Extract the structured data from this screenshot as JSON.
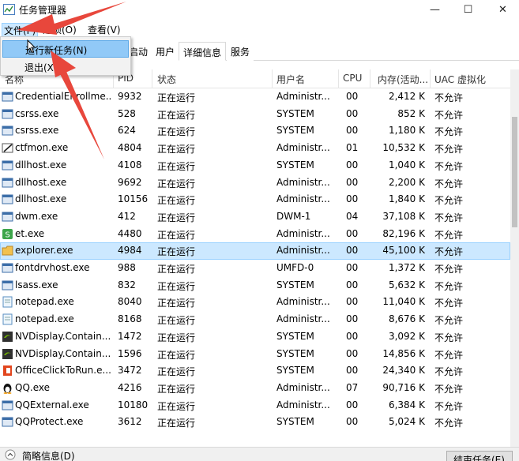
{
  "window": {
    "title": "任务管理器",
    "minimize": "—",
    "maximize": "☐",
    "close": "✕"
  },
  "menu": {
    "file": "文件(F)",
    "options": "选项(O)",
    "view": "查看(V)"
  },
  "dropdown": {
    "run_new_task": "运行新任务(N)",
    "exit": "退出(X)"
  },
  "tabs": [
    "启动",
    "用户",
    "详细信息",
    "服务"
  ],
  "columns": {
    "name": "名称",
    "pid": "PID",
    "status": "状态",
    "user": "用户名",
    "cpu": "CPU",
    "memory": "内存(活动...",
    "uac": "UAC 虚拟化"
  },
  "processes": [
    {
      "name": "CredentialEnrollme...",
      "pid": "9932",
      "status": "正在运行",
      "user": "Administr...",
      "cpu": "00",
      "mem": "2,412 K",
      "uac": "不允许",
      "icon": "window-icon"
    },
    {
      "name": "csrss.exe",
      "pid": "528",
      "status": "正在运行",
      "user": "SYSTEM",
      "cpu": "00",
      "mem": "852 K",
      "uac": "不允许",
      "icon": "window-icon"
    },
    {
      "name": "csrss.exe",
      "pid": "624",
      "status": "正在运行",
      "user": "SYSTEM",
      "cpu": "00",
      "mem": "1,180 K",
      "uac": "不允许",
      "icon": "window-icon"
    },
    {
      "name": "ctfmon.exe",
      "pid": "4804",
      "status": "正在运行",
      "user": "Administr...",
      "cpu": "01",
      "mem": "10,532 K",
      "uac": "不允许",
      "icon": "pen-icon"
    },
    {
      "name": "dllhost.exe",
      "pid": "4108",
      "status": "正在运行",
      "user": "SYSTEM",
      "cpu": "00",
      "mem": "1,040 K",
      "uac": "不允许",
      "icon": "window-icon"
    },
    {
      "name": "dllhost.exe",
      "pid": "9692",
      "status": "正在运行",
      "user": "Administr...",
      "cpu": "00",
      "mem": "2,200 K",
      "uac": "不允许",
      "icon": "window-icon"
    },
    {
      "name": "dllhost.exe",
      "pid": "10156",
      "status": "正在运行",
      "user": "Administr...",
      "cpu": "00",
      "mem": "1,840 K",
      "uac": "不允许",
      "icon": "window-icon"
    },
    {
      "name": "dwm.exe",
      "pid": "412",
      "status": "正在运行",
      "user": "DWM-1",
      "cpu": "04",
      "mem": "37,108 K",
      "uac": "不允许",
      "icon": "window-icon"
    },
    {
      "name": "et.exe",
      "pid": "4480",
      "status": "正在运行",
      "user": "Administr...",
      "cpu": "00",
      "mem": "82,196 K",
      "uac": "不允许",
      "icon": "spreadsheet-icon"
    },
    {
      "name": "explorer.exe",
      "pid": "4984",
      "status": "正在运行",
      "user": "Administr...",
      "cpu": "00",
      "mem": "45,100 K",
      "uac": "不允许",
      "icon": "folder-icon"
    },
    {
      "name": "fontdrvhost.exe",
      "pid": "988",
      "status": "正在运行",
      "user": "UMFD-0",
      "cpu": "00",
      "mem": "1,372 K",
      "uac": "不允许",
      "icon": "window-icon"
    },
    {
      "name": "lsass.exe",
      "pid": "832",
      "status": "正在运行",
      "user": "SYSTEM",
      "cpu": "00",
      "mem": "5,632 K",
      "uac": "不允许",
      "icon": "window-icon"
    },
    {
      "name": "notepad.exe",
      "pid": "8040",
      "status": "正在运行",
      "user": "Administr...",
      "cpu": "00",
      "mem": "11,040 K",
      "uac": "不允许",
      "icon": "notepad-icon"
    },
    {
      "name": "notepad.exe",
      "pid": "8168",
      "status": "正在运行",
      "user": "Administr...",
      "cpu": "00",
      "mem": "8,676 K",
      "uac": "不允许",
      "icon": "notepad-icon"
    },
    {
      "name": "NVDisplay.Contain...",
      "pid": "1472",
      "status": "正在运行",
      "user": "SYSTEM",
      "cpu": "00",
      "mem": "3,092 K",
      "uac": "不允许",
      "icon": "nvidia-icon"
    },
    {
      "name": "NVDisplay.Contain...",
      "pid": "1596",
      "status": "正在运行",
      "user": "SYSTEM",
      "cpu": "00",
      "mem": "14,856 K",
      "uac": "不允许",
      "icon": "nvidia-icon"
    },
    {
      "name": "OfficeClickToRun.e...",
      "pid": "3472",
      "status": "正在运行",
      "user": "SYSTEM",
      "cpu": "00",
      "mem": "24,340 K",
      "uac": "不允许",
      "icon": "office-icon"
    },
    {
      "name": "QQ.exe",
      "pid": "4216",
      "status": "正在运行",
      "user": "Administr...",
      "cpu": "07",
      "mem": "90,716 K",
      "uac": "不允许",
      "icon": "qq-penguin-icon"
    },
    {
      "name": "QQExternal.exe",
      "pid": "10180",
      "status": "正在运行",
      "user": "Administr...",
      "cpu": "00",
      "mem": "6,384 K",
      "uac": "不允许",
      "icon": "window-icon"
    },
    {
      "name": "QQProtect.exe",
      "pid": "3612",
      "status": "正在运行",
      "user": "SYSTEM",
      "cpu": "00",
      "mem": "5,024 K",
      "uac": "不允许",
      "icon": "window-icon"
    }
  ],
  "footer": {
    "details": "简略信息(D)",
    "end_task": "结束任务(E)"
  },
  "colors": {
    "selection": "#cce8ff",
    "arrow": "#e8473c"
  }
}
